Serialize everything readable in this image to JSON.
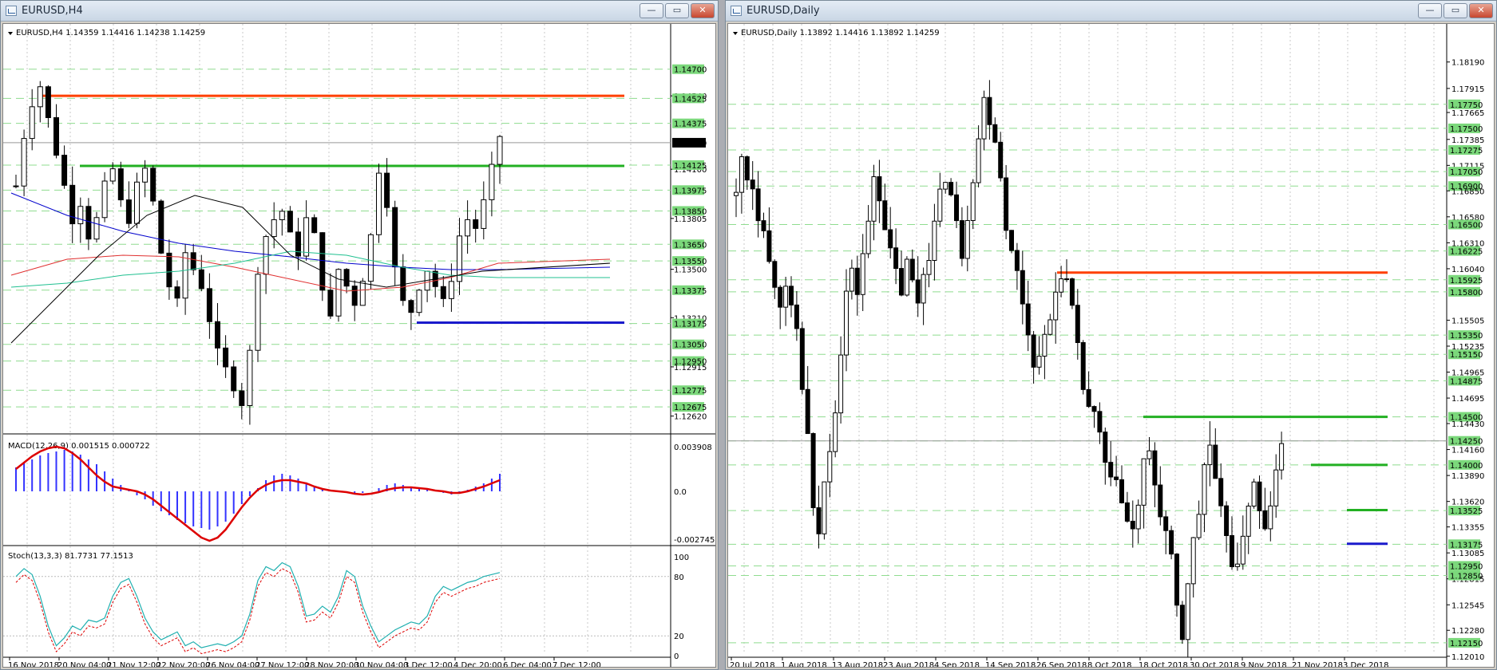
{
  "left_window": {
    "title": "EURUSD,H4",
    "buttons": {
      "minimize": "—",
      "restore": "▭",
      "close": "✕"
    },
    "main_info": "EURUSD,H4  1.14359 1.14416 1.14238 1.14259",
    "current_price": "1.14259",
    "price_levels": [
      {
        "label": "1.14700",
        "price": 1.147,
        "green": true
      },
      {
        "label": "1.14540",
        "price": 1.1454,
        "green": false
      },
      {
        "label": "1.14525",
        "price": 1.14525,
        "green": true
      },
      {
        "label": "1.14375",
        "price": 1.14375,
        "green": true
      },
      {
        "label": "1.14100",
        "price": 1.141,
        "green": false
      },
      {
        "label": "1.14125",
        "price": 1.14125,
        "green": true
      },
      {
        "label": "1.13975",
        "price": 1.13975,
        "green": true
      },
      {
        "label": "1.13850",
        "price": 1.1385,
        "green": true
      },
      {
        "label": "1.13805",
        "price": 1.13805,
        "green": false
      },
      {
        "label": "1.13650",
        "price": 1.1365,
        "green": true
      },
      {
        "label": "1.13550",
        "price": 1.1355,
        "green": true
      },
      {
        "label": "1.13500",
        "price": 1.135,
        "green": false
      },
      {
        "label": "1.13375",
        "price": 1.13375,
        "green": true
      },
      {
        "label": "1.13210",
        "price": 1.1321,
        "green": false
      },
      {
        "label": "1.13175",
        "price": 1.13175,
        "green": true
      },
      {
        "label": "1.13050",
        "price": 1.1305,
        "green": true
      },
      {
        "label": "1.12950",
        "price": 1.1295,
        "green": true
      },
      {
        "label": "1.12915",
        "price": 1.12915,
        "green": false
      },
      {
        "label": "1.12775",
        "price": 1.12775,
        "green": true
      },
      {
        "label": "1.12675",
        "price": 1.12675,
        "green": true
      },
      {
        "label": "1.12620",
        "price": 1.1262,
        "green": false
      }
    ],
    "macd_info": "MACD(12,26,9) 0.001515 0.000722",
    "macd_scale": [
      "0.003908",
      "0.0",
      "-0.002745"
    ],
    "stoch_info": "Stoch(13,3,3) 81.7731 77.1513",
    "stoch_scale": [
      "100",
      "80",
      "20",
      "0"
    ],
    "time_labels": [
      "16 Nov 2018",
      "20 Nov 04:00",
      "21 Nov 12:00",
      "22 Nov 20:00",
      "26 Nov 04:00",
      "27 Nov 12:00",
      "28 Nov 20:00",
      "30 Nov 04:00",
      "3 Dec 12:00",
      "4 Dec 20:00",
      "6 Dec 04:00",
      "7 Dec 12:00"
    ],
    "lines": {
      "red": 1.1454,
      "green": 1.1412,
      "blue": 1.1318
    }
  },
  "right_window": {
    "title": "EURUSD,Daily",
    "buttons": {
      "minimize": "—",
      "restore": "▭",
      "close": "✕"
    },
    "main_info": "EURUSD,Daily  1.13892 1.14416 1.13892 1.14259",
    "current_price": "1.14259",
    "price_levels": [
      {
        "label": "1.18190",
        "price": 1.1819,
        "green": false
      },
      {
        "label": "1.17915",
        "price": 1.17915,
        "green": false
      },
      {
        "label": "1.17750",
        "price": 1.1775,
        "green": true
      },
      {
        "label": "1.17665",
        "price": 1.17665,
        "green": false
      },
      {
        "label": "1.17500",
        "price": 1.175,
        "green": true
      },
      {
        "label": "1.17385",
        "price": 1.17385,
        "green": false
      },
      {
        "label": "1.17275",
        "price": 1.17275,
        "green": true
      },
      {
        "label": "1.17115",
        "price": 1.17115,
        "green": false
      },
      {
        "label": "1.17050",
        "price": 1.1705,
        "green": true
      },
      {
        "label": "1.16900",
        "price": 1.169,
        "green": true
      },
      {
        "label": "1.16850",
        "price": 1.1685,
        "green": false
      },
      {
        "label": "1.16580",
        "price": 1.1658,
        "green": false
      },
      {
        "label": "1.16500",
        "price": 1.165,
        "green": true
      },
      {
        "label": "1.16310",
        "price": 1.1631,
        "green": false
      },
      {
        "label": "1.16225",
        "price": 1.16225,
        "green": true
      },
      {
        "label": "1.16040",
        "price": 1.1604,
        "green": false
      },
      {
        "label": "1.15925",
        "price": 1.15925,
        "green": true
      },
      {
        "label": "1.15800",
        "price": 1.158,
        "green": true
      },
      {
        "label": "1.15505",
        "price": 1.15505,
        "green": false
      },
      {
        "label": "1.15350",
        "price": 1.1535,
        "green": true
      },
      {
        "label": "1.15235",
        "price": 1.15235,
        "green": false
      },
      {
        "label": "1.15150",
        "price": 1.1515,
        "green": true
      },
      {
        "label": "1.14965",
        "price": 1.14965,
        "green": false
      },
      {
        "label": "1.14875",
        "price": 1.14875,
        "green": true
      },
      {
        "label": "1.14695",
        "price": 1.14695,
        "green": false
      },
      {
        "label": "1.14500",
        "price": 1.145,
        "green": true
      },
      {
        "label": "1.14430",
        "price": 1.1443,
        "green": false
      },
      {
        "label": "1.14250",
        "price": 1.1425,
        "green": true
      },
      {
        "label": "1.14160",
        "price": 1.1416,
        "green": false
      },
      {
        "label": "1.14000",
        "price": 1.14,
        "green": true
      },
      {
        "label": "1.13890",
        "price": 1.1389,
        "green": false
      },
      {
        "label": "1.13620",
        "price": 1.1362,
        "green": false
      },
      {
        "label": "1.13525",
        "price": 1.13525,
        "green": true
      },
      {
        "label": "1.13355",
        "price": 1.13355,
        "green": false
      },
      {
        "label": "1.13175",
        "price": 1.13175,
        "green": true
      },
      {
        "label": "1.13085",
        "price": 1.13085,
        "green": false
      },
      {
        "label": "1.12950",
        "price": 1.1295,
        "green": true
      },
      {
        "label": "1.12815",
        "price": 1.12815,
        "green": false
      },
      {
        "label": "1.12850",
        "price": 1.1285,
        "green": true
      },
      {
        "label": "1.12545",
        "price": 1.12545,
        "green": false
      },
      {
        "label": "1.12280",
        "price": 1.1228,
        "green": false
      },
      {
        "label": "1.12150",
        "price": 1.1215,
        "green": true
      },
      {
        "label": "1.12010",
        "price": 1.1201,
        "green": false
      }
    ],
    "time_labels": [
      "20 Jul 2018",
      "1 Aug 2018",
      "13 Aug 2018",
      "23 Aug 2018",
      "4 Sep 2018",
      "14 Sep 2018",
      "26 Sep 2018",
      "8 Oct 2018",
      "18 Oct 2018",
      "30 Oct 2018",
      "9 Nov 2018",
      "21 Nov 2018",
      "3 Dec 2018"
    ],
    "lines": {
      "red": 1.16,
      "green1": 1.145,
      "green2": 1.14,
      "green3": 1.1353,
      "blue": 1.1318
    }
  }
}
